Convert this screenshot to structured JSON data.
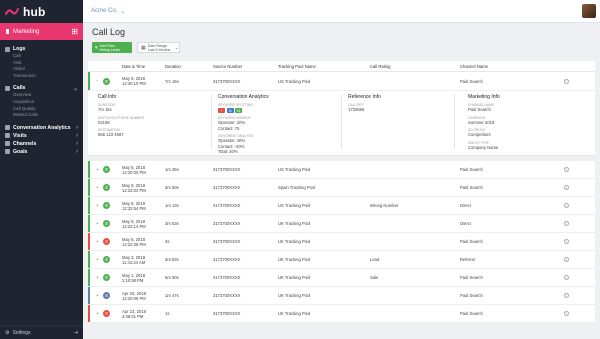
{
  "brand": {
    "logo_text": "hub",
    "brand_pink": "#e8366f",
    "accent_green": "#4caf50"
  },
  "sidebar": {
    "top_item": "Marketing",
    "sections": [
      {
        "label": "Logs",
        "items": [
          "Call",
          "Visit",
          "Visitor",
          "Transaction"
        ]
      },
      {
        "label": "Calls",
        "items": [
          "Overview",
          "Acquisition",
          "Call Quality",
          "Missed Calls"
        ]
      },
      {
        "label": "Conversation Analytics",
        "items": []
      },
      {
        "label": "Visits",
        "items": []
      },
      {
        "label": "Channels",
        "items": []
      },
      {
        "label": "Goals",
        "items": []
      }
    ],
    "settings": "Settings"
  },
  "topbar": {
    "account": "Acme Co."
  },
  "page": {
    "title": "Call Log",
    "add_filter": [
      "Add Filter",
      "Hiding Limits"
    ],
    "date_range": [
      "Date Range",
      "Last 6 Months"
    ]
  },
  "table": {
    "headers": [
      "Date & Time",
      "Duration",
      "Source Number",
      "Tracking Pool Name",
      "Call Rating",
      "Channel Name"
    ],
    "expanded_row": {
      "date": "May 8, 2018",
      "time": "12:20:10 PM",
      "duration": "7m 15s",
      "source": "3173700XXXX",
      "pool": "US Tracking Pool",
      "rating": "",
      "channel": "Paid Search",
      "status": "green"
    },
    "details": {
      "call_info": {
        "heading": "Call Info",
        "duration_label": "DURATION",
        "duration": "7m 15s",
        "displayed_label": "DISPLAYED PHONE NUMBER",
        "displayed": "02198",
        "destination_label": "DESTINATION",
        "destination": "555 123 4567"
      },
      "analytics": {
        "heading": "Conversation Analytics",
        "keyword_label": "KEYWORD SPOTTING",
        "keywords": [
          "7",
          "10",
          "15"
        ],
        "keyword_colors": [
          "#e74c3c",
          "#3b78c8",
          "#4caf50"
        ],
        "talk_label": "KEYWORD MOMENT",
        "operator": "Operator: 20%",
        "contact": "Contact: 75",
        "sentiment_label": "SENTIMENT ANALYSIS",
        "s_operator": "Operator: 40%",
        "s_contact": "Contact: -20%",
        "s_total": "Total: 20%"
      },
      "ref_info": {
        "heading": "Reference Info",
        "call_id_label": "CALL REF",
        "call_id": "1733659"
      },
      "marketing": {
        "heading": "Marketing Info",
        "channel_label": "CHANNEL NAME",
        "channel": "Paid Search",
        "campaign_label": "CAMPAIGN",
        "campaign": "Summer 2018",
        "ad_group_label": "AD GROUP",
        "ad_group": "Competitors",
        "match_label": "MATCH TYPE",
        "company": "Company Name"
      }
    },
    "rows": [
      {
        "date": "May 8, 2018",
        "time": "12:20:00 PM",
        "duration": "1m 35s",
        "source": "3173700XXXX",
        "pool": "US Tracking Pool",
        "rating": "",
        "channel": "Paid Search",
        "status": "green"
      },
      {
        "date": "May 8, 2018",
        "time": "12:23:03 PM",
        "duration": "2m 50s",
        "source": "3173700XXXX",
        "pool": "Spain Tracking Pool",
        "rating": "",
        "channel": "Paid Search",
        "status": "green"
      },
      {
        "date": "May 8, 2018",
        "time": "12:22:54 PM",
        "duration": "1m 13s",
        "source": "3173700XXXX",
        "pool": "US Tracking Pool",
        "rating": "Wrong Number",
        "channel": "Direct",
        "status": "green"
      },
      {
        "date": "May 8, 2018",
        "time": "12:22:14 PM",
        "duration": "3m 53s",
        "source": "3173700XXXX",
        "pool": "UK Tracking Pool",
        "rating": "",
        "channel": "Direct",
        "status": "green"
      },
      {
        "date": "May 8, 2018",
        "time": "12:22:38 PM",
        "duration": "4s",
        "source": "3173700XXXX",
        "pool": "UK Tracking Pool",
        "rating": "",
        "channel": "Paid Search",
        "status": "red"
      },
      {
        "date": "May 3, 2018",
        "time": "11:44:24 AM",
        "duration": "2m 53s",
        "source": "3173700XXXX",
        "pool": "UK Tracking Pool",
        "rating": "Lead",
        "channel": "Referrer",
        "status": "green"
      },
      {
        "date": "May 1, 2018",
        "time": "2:10:58 PM",
        "duration": "5m 50s",
        "source": "3173700XXXX",
        "pool": "UK Tracking Pool",
        "rating": "Sale",
        "channel": "Paid Search",
        "status": "green"
      },
      {
        "date": "Apr 25, 2018",
        "time": "12:20:06 PM",
        "duration": "1m 47s",
        "source": "3173700XXXX",
        "pool": "UK Tracking Pool",
        "rating": "",
        "channel": "Paid Search",
        "status": "blue"
      },
      {
        "date": "Apr 23, 2018",
        "time": "4:38:01 PM",
        "duration": "1s",
        "source": "3173700XXXX",
        "pool": "UK Tracking Pool",
        "rating": "",
        "channel": "Paid Search",
        "status": "red"
      }
    ]
  }
}
